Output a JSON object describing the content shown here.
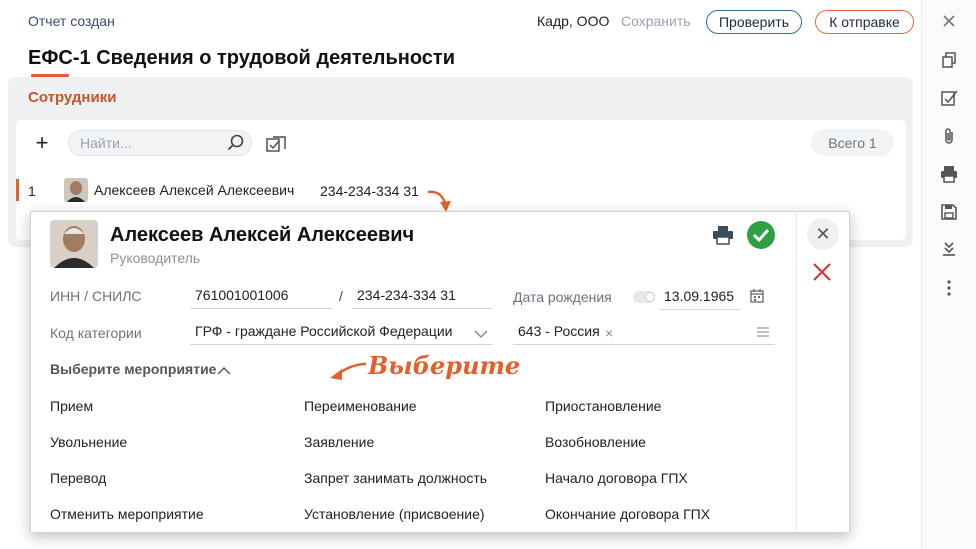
{
  "header": {
    "status": "Отчет создан",
    "organization": "Кадр, ООО",
    "save_label": "Сохранить",
    "check_label": "Проверить",
    "send_label": "К отправке",
    "title": "ЕФС-1 Сведения о трудовой деятельности"
  },
  "employees": {
    "section_title": "Сотрудники",
    "search_placeholder": "Найти...",
    "total_label": "Всего 1",
    "rows": [
      {
        "num": "1",
        "name": "Алексеев Алексей Алексеевич",
        "snils": "234-234-334 31"
      }
    ]
  },
  "card": {
    "name": "Алексеев Алексей Алексеевич",
    "role": "Руководитель",
    "inn_snils_label": "ИНН / СНИЛС",
    "inn": "761001001006",
    "separator": "/",
    "snils": "234-234-334 31",
    "dob_label": "Дата рождения",
    "dob": "13.09.1965",
    "category_label": "Код категории",
    "category": "ГРФ - граждане Российской Федерации",
    "country": "643 - Россия",
    "choose_event_label": "Выберите мероприятие",
    "annotation": "Выберите",
    "events": [
      [
        "Прием",
        "Переименование",
        "Приостановление"
      ],
      [
        "Увольнение",
        "Заявление",
        "Возобновление"
      ],
      [
        "Перевод",
        "Запрет занимать должность",
        "Начало договора ГПХ"
      ],
      [
        "Отменить мероприятие",
        "Установление (присвоение)",
        "Окончание договора ГПХ"
      ]
    ]
  },
  "toolbar_icons": [
    "close-icon",
    "copy-icon",
    "checklist-icon",
    "attach-icon",
    "printer-icon",
    "save-icon",
    "import-icon",
    "more-icon"
  ],
  "colors": {
    "accent": "#e2612b",
    "ok": "#2ea043",
    "check_border": "#2d6ea8"
  }
}
